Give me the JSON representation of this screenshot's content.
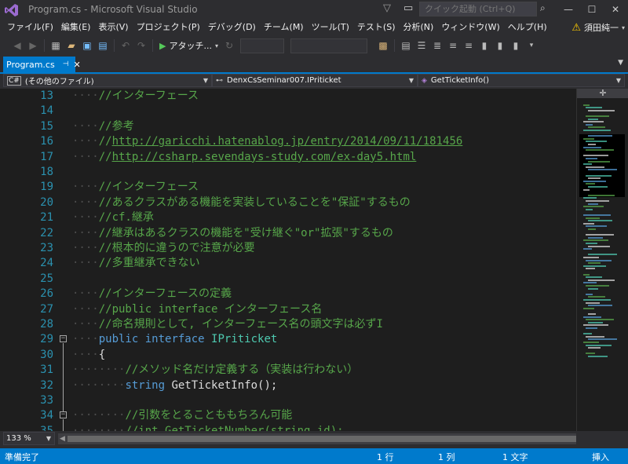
{
  "window": {
    "title": "Program.cs - Microsoft Visual Studio",
    "quick_launch_placeholder": "クイック起動 (Ctrl+Q)"
  },
  "menu": [
    "ファイル(F)",
    "編集(E)",
    "表示(V)",
    "プロジェクト(P)",
    "デバッグ(D)",
    "チーム(M)",
    "ツール(T)",
    "テスト(S)",
    "分析(N)",
    "ウィンドウ(W)",
    "ヘルプ(H)"
  ],
  "user": {
    "name": "須田純一"
  },
  "toolbar": {
    "start_label": "アタッチ..."
  },
  "tab": {
    "label": "Program.cs"
  },
  "navbar": {
    "project": "(その他のファイル)",
    "class": "DenxCsSeminar007.IPriticket",
    "member": "GetTicketInfo()"
  },
  "code": [
    {
      "n": "13",
      "indent": 2,
      "parts": [
        [
          "cm",
          "//インターフェース"
        ]
      ]
    },
    {
      "n": "14",
      "indent": 0,
      "parts": []
    },
    {
      "n": "15",
      "indent": 2,
      "parts": [
        [
          "cm",
          "//参考"
        ]
      ]
    },
    {
      "n": "16",
      "indent": 2,
      "parts": [
        [
          "cm",
          "//"
        ],
        [
          "link",
          "http://garicchi.hatenablog.jp/entry/2014/09/11/181456"
        ]
      ]
    },
    {
      "n": "17",
      "indent": 2,
      "parts": [
        [
          "cm",
          "//"
        ],
        [
          "link",
          "http://csharp.sevendays-study.com/ex-day5.html"
        ]
      ]
    },
    {
      "n": "18",
      "indent": 0,
      "parts": []
    },
    {
      "n": "19",
      "indent": 2,
      "parts": [
        [
          "cm",
          "//インターフェース"
        ]
      ]
    },
    {
      "n": "20",
      "indent": 2,
      "parts": [
        [
          "cm",
          "//あるクラスがある機能を実装していることを\"保証\"するもの"
        ]
      ]
    },
    {
      "n": "21",
      "indent": 2,
      "parts": [
        [
          "cm",
          "//cf.継承"
        ]
      ]
    },
    {
      "n": "22",
      "indent": 2,
      "parts": [
        [
          "cm",
          "//継承はあるクラスの機能を\"受け継ぐ\"or\"拡張\"するもの"
        ]
      ]
    },
    {
      "n": "23",
      "indent": 2,
      "parts": [
        [
          "cm",
          "//根本的に違うので注意が必要"
        ]
      ]
    },
    {
      "n": "24",
      "indent": 2,
      "parts": [
        [
          "cm",
          "//多重継承できない"
        ]
      ]
    },
    {
      "n": "25",
      "indent": 0,
      "parts": []
    },
    {
      "n": "26",
      "indent": 2,
      "parts": [
        [
          "cm",
          "//インターフェースの定義"
        ]
      ]
    },
    {
      "n": "27",
      "indent": 2,
      "parts": [
        [
          "cm",
          "//public interface インターフェース名"
        ]
      ]
    },
    {
      "n": "28",
      "indent": 2,
      "parts": [
        [
          "cm",
          "//命名規則として, インターフェース名の頭文字は必ずI"
        ]
      ]
    },
    {
      "n": "29",
      "indent": 2,
      "fold": true,
      "parts": [
        [
          "kw",
          "public"
        ],
        [
          "pl",
          " "
        ],
        [
          "kw",
          "interface"
        ],
        [
          "pl",
          " "
        ],
        [
          "cls",
          "IPriticket"
        ]
      ]
    },
    {
      "n": "30",
      "indent": 2,
      "parts": [
        [
          "pl",
          "{"
        ]
      ]
    },
    {
      "n": "31",
      "indent": 4,
      "parts": [
        [
          "cm",
          "//メソッド名だけ定義する（実装は行わない）"
        ]
      ]
    },
    {
      "n": "32",
      "indent": 4,
      "parts": [
        [
          "kw",
          "string"
        ],
        [
          "pl",
          " GetTicketInfo();"
        ]
      ]
    },
    {
      "n": "33",
      "indent": 0,
      "parts": []
    },
    {
      "n": "34",
      "indent": 4,
      "fold": true,
      "parts": [
        [
          "cm",
          "//引数をとることももちろん可能"
        ]
      ]
    },
    {
      "n": "35",
      "indent": 4,
      "parts": [
        [
          "cm",
          "//int GetTicketNumber(string id);"
        ]
      ]
    }
  ],
  "zoom": "133 %",
  "status": {
    "ready": "準備完了",
    "line": "1 行",
    "col": "1 列",
    "char": "1 文字",
    "mode": "挿入"
  }
}
